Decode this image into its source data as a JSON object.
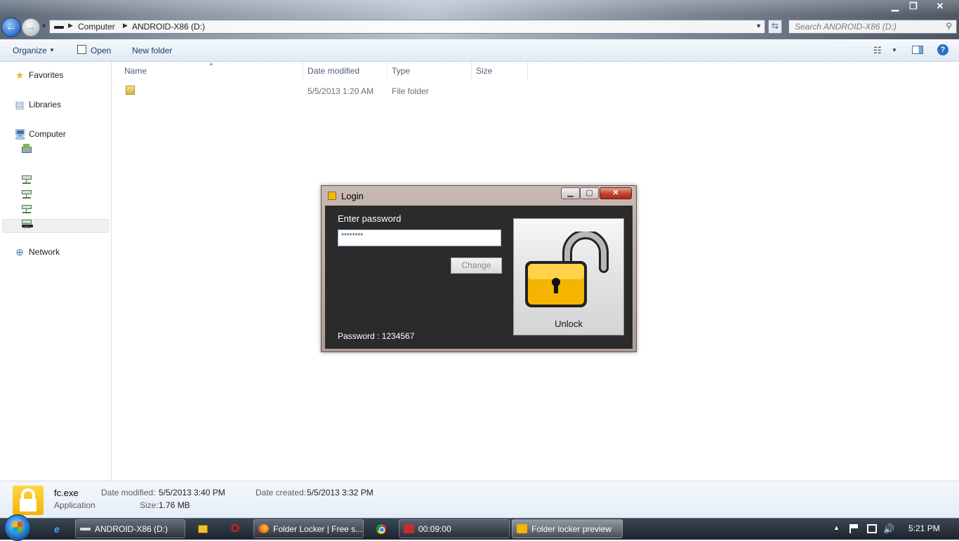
{
  "window": {
    "min_glyph": "▁",
    "max_glyph": "❐",
    "close_glyph": "✕"
  },
  "address": {
    "crumb_computer": "Computer",
    "crumb_drive": "ANDROID-X86 (D:)",
    "separator": "▶"
  },
  "search": {
    "placeholder": "Search ANDROID-X86 (D:)"
  },
  "toolbar": {
    "organize": "Organize",
    "open": "Open",
    "new_folder": "New folder"
  },
  "nav": {
    "favorites": "Favorites",
    "libraries": "Libraries",
    "computer": "Computer",
    "network": "Network"
  },
  "columns": {
    "name": "Name",
    "date_modified": "Date modified",
    "type": "Type",
    "size": "Size"
  },
  "files": [
    {
      "name": "",
      "date_modified": "5/5/2013 1:20 AM",
      "type": "File folder",
      "size": ""
    }
  ],
  "login_dialog": {
    "title": "Login",
    "enter_password_label": "Enter password",
    "password_value": "********",
    "change_button": "Change",
    "unlock_button": "Unlock",
    "password_hint": "Password : 1234567"
  },
  "details": {
    "filename": "fc.exe",
    "file_type": "Application",
    "date_modified_label": "Date modified:",
    "date_modified": "5/5/2013 3:40 PM",
    "size_label": "Size:",
    "size": "1.76 MB",
    "date_created_label": "Date created:",
    "date_created": "5/5/2013 3:32 PM"
  },
  "taskbar": {
    "tasks": [
      {
        "label": "ANDROID-X86 (D:)"
      },
      {
        "label": "Folder Locker | Free s..."
      },
      {
        "label": "00:09:00"
      },
      {
        "label": "Folder locker preview"
      }
    ],
    "clock": "5:21 PM"
  },
  "colors": {
    "dialog_body": "#2b2b2b",
    "padlock": "#f4b400",
    "accent": "#2b6fc6"
  }
}
